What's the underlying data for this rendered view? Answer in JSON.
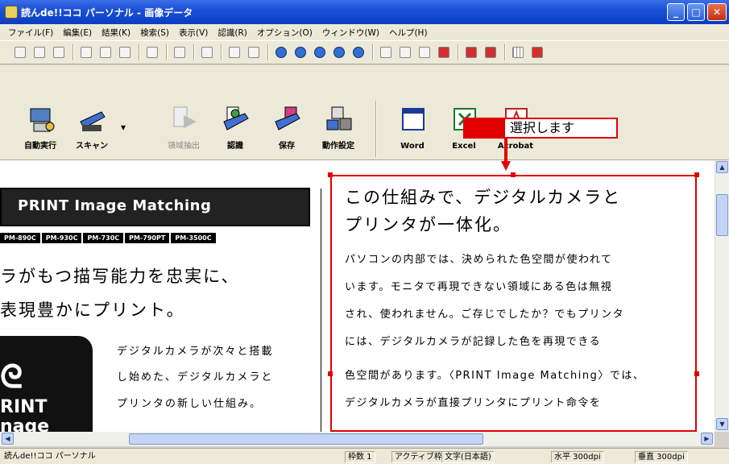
{
  "window": {
    "title": "読んde!!ココ パーソナル - 画像データ"
  },
  "menu": [
    "ファイル(F)",
    "編集(E)",
    "結果(K)",
    "検索(S)",
    "表示(V)",
    "認識(R)",
    "オプション(O)",
    "ウィンドウ(W)",
    "ヘルプ(H)"
  ],
  "toolbar_large": [
    {
      "label": "自動実行",
      "icon": "auto-run-icon",
      "enabled": true
    },
    {
      "label": "スキャン",
      "icon": "scanner-icon",
      "enabled": true
    },
    {
      "label": "領域抽出",
      "icon": "area-extract-icon",
      "enabled": false
    },
    {
      "label": "認識",
      "icon": "recognize-icon",
      "enabled": true
    },
    {
      "label": "保存",
      "icon": "save-icon",
      "enabled": true
    },
    {
      "label": "動作設定",
      "icon": "settings-icon",
      "enabled": true
    },
    {
      "label": "Word",
      "icon": "word-icon",
      "enabled": true
    },
    {
      "label": "Excel",
      "icon": "excel-icon",
      "enabled": true
    },
    {
      "label": "Acrobat",
      "icon": "acrobat-icon",
      "enabled": true
    }
  ],
  "callout": {
    "text": "選択します",
    "color": "#e00000"
  },
  "left_doc": {
    "banner": "PRINT Image Matching",
    "models": [
      "PM-890C",
      "PM-930C",
      "PM-730C",
      "PM-790PT",
      "PM-3500C"
    ],
    "heading1": "ラがもつ描写能力を忠実に、",
    "heading2": "表現豊かにプリント。",
    "logo_lines": [
      "RINT",
      "nage"
    ],
    "lines": [
      "デジタルカメラが次々と搭載",
      "し始めた、デジタルカメラと",
      "プリンタの新しい仕組み。"
    ]
  },
  "right_doc": {
    "heading1": "この仕組みで、デジタルカメラと",
    "heading2": "プリンタが一体化。",
    "lines": [
      "パソコンの内部では、決められた色空間が使われて",
      "います。モニタで再現できない領域にある色は無視",
      "され、使われません。ご存じでしたか？でもプリンタ",
      "には、デジタルカメラが記録した色を再現できる",
      "色空間があります。〈PRINT Image Matching〉では、",
      "デジタルカメラが直接プリンタにプリント命令を"
    ]
  },
  "status": {
    "app": "読んde!!ココ パーソナル",
    "frames": "枠数 1",
    "active": "アクティブ枠",
    "lang": "文字(日本語)",
    "hdpi": "水平 300dpi",
    "vdpi": "垂直 300dpi"
  }
}
